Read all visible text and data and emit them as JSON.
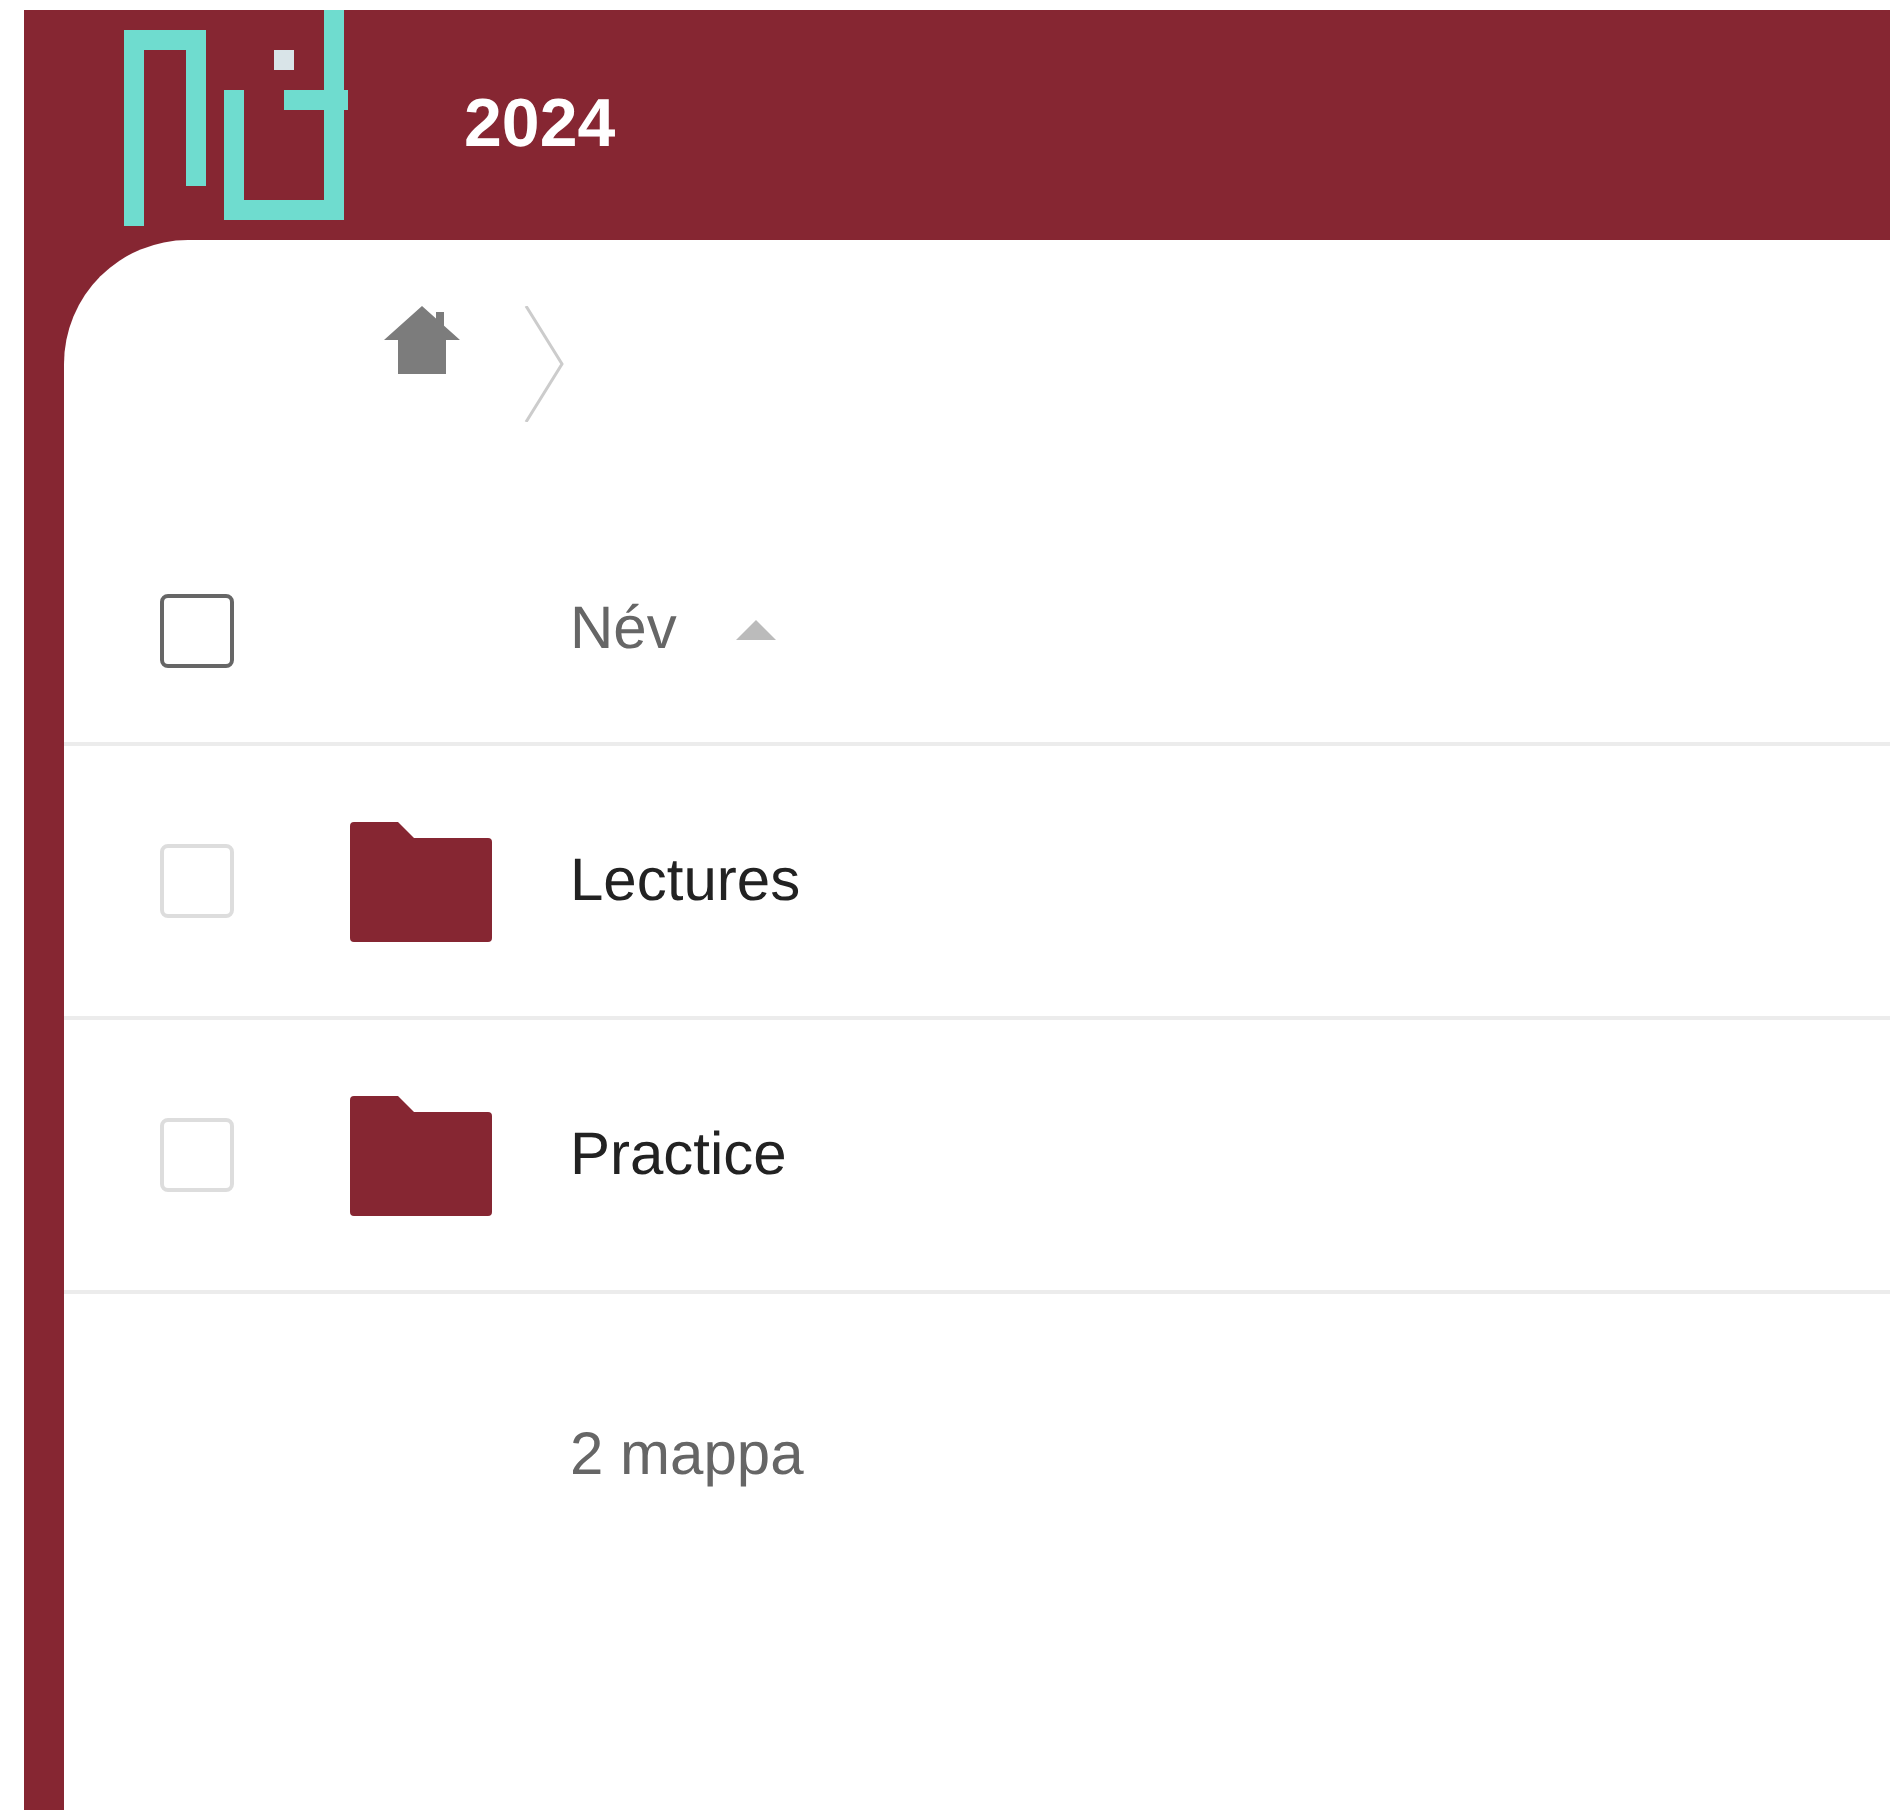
{
  "header": {
    "title": "2024"
  },
  "table": {
    "select_all_checked": false,
    "columns": [
      {
        "label": "Név",
        "sorted_ascending": true
      }
    ],
    "rows": [
      {
        "name": "Lectures",
        "kind": "folder",
        "checked": false
      },
      {
        "name": "Practice",
        "kind": "folder",
        "checked": false
      }
    ]
  },
  "summary": "2 mappa"
}
